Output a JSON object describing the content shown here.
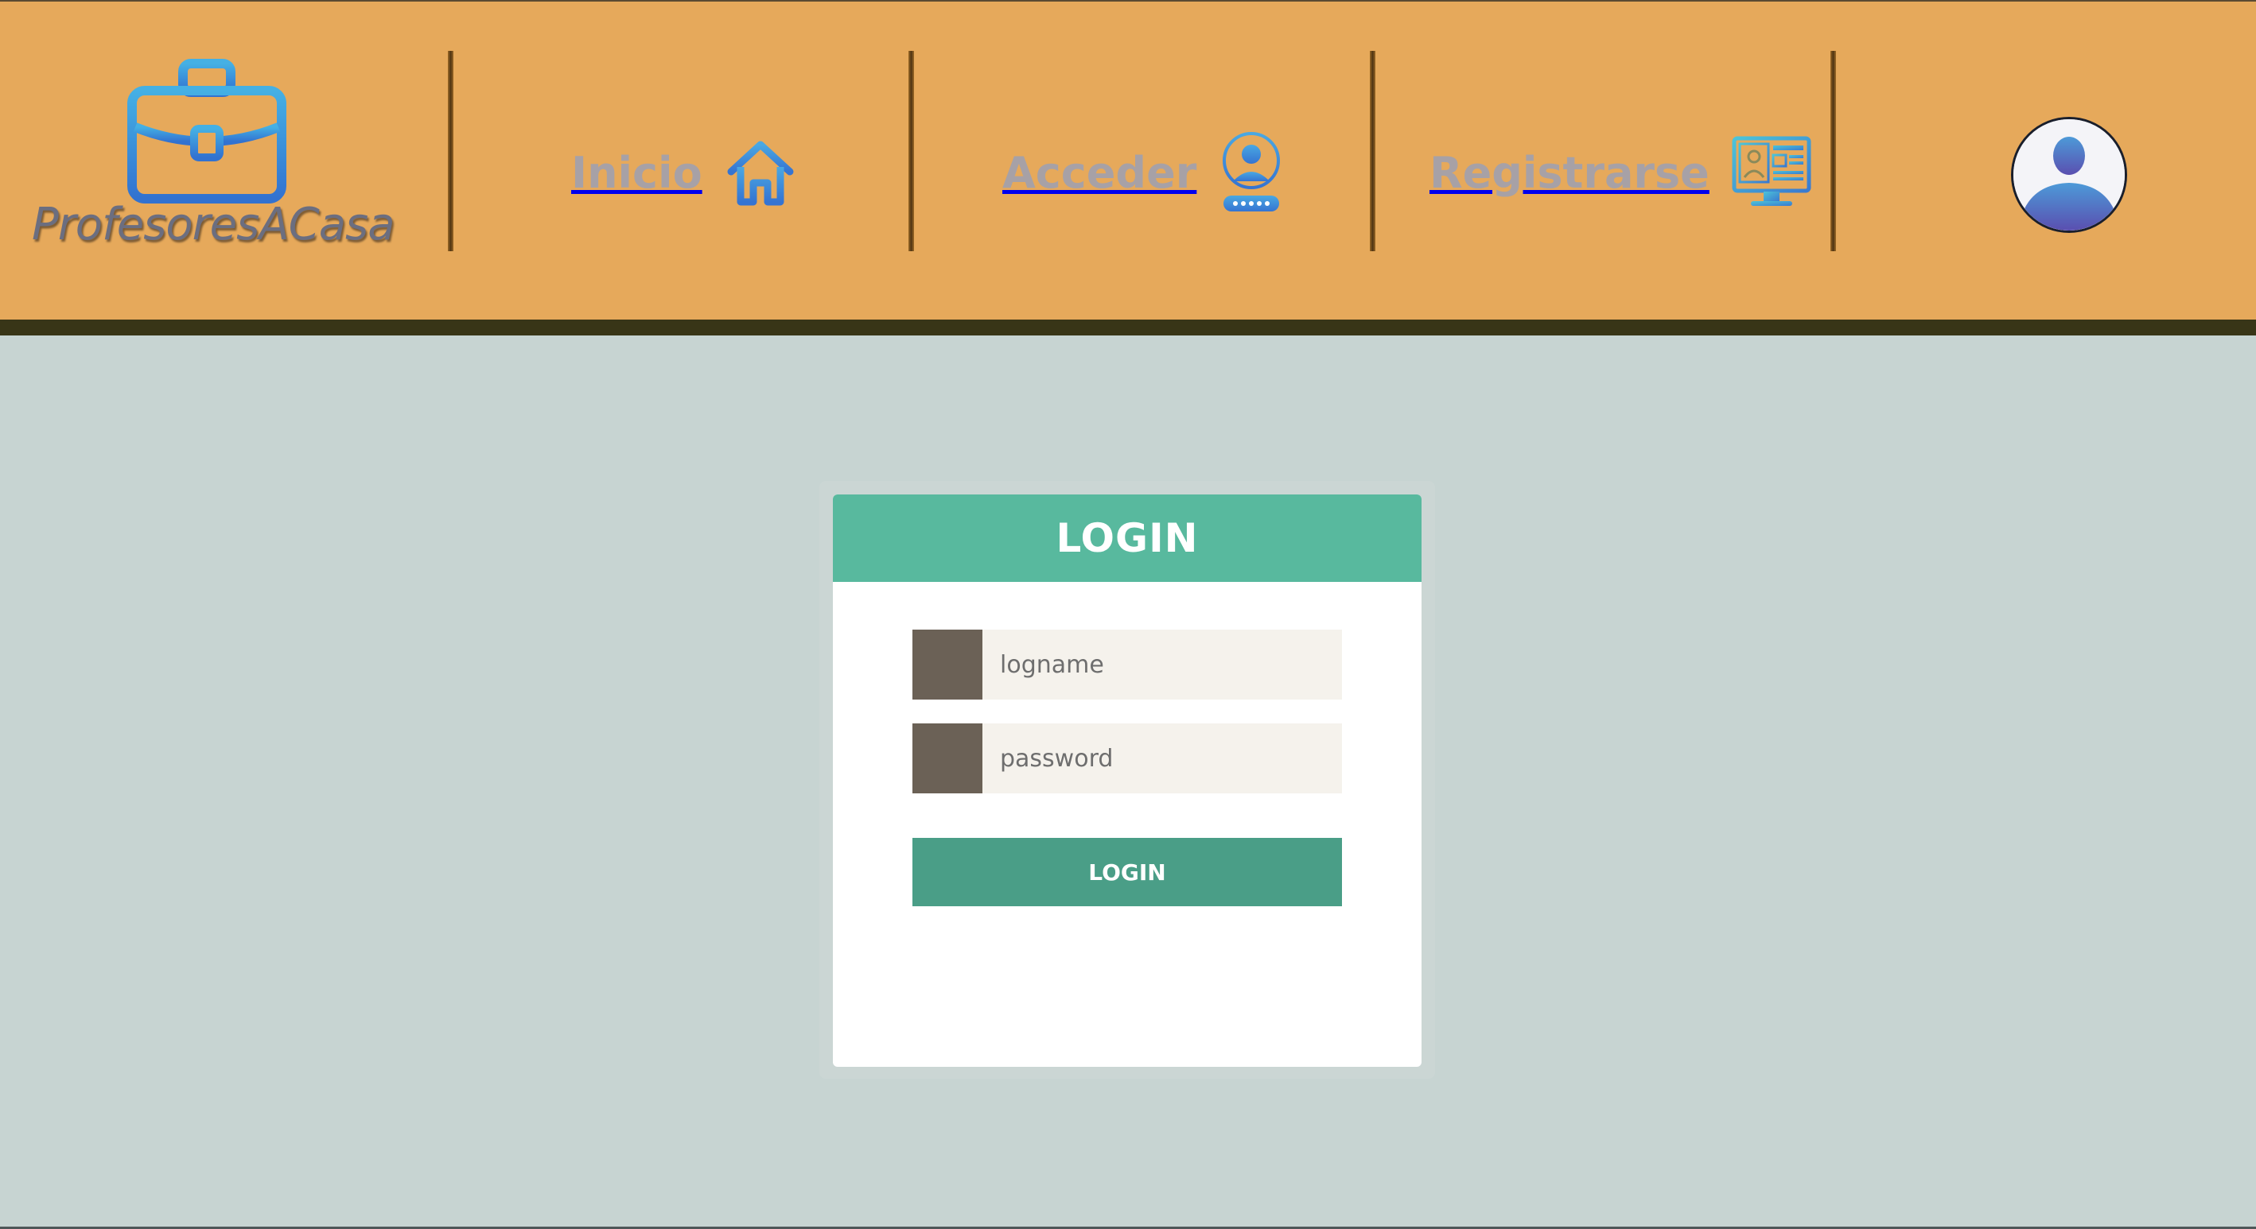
{
  "app": {
    "logo_text": "ProfesoresACasa"
  },
  "nav": {
    "items": [
      {
        "label": "Inicio",
        "icon": "home-icon"
      },
      {
        "label": "Acceder",
        "icon": "user-login-icon"
      },
      {
        "label": "Registrarse",
        "icon": "register-monitor-icon"
      }
    ],
    "avatar_icon": "user-avatar-icon"
  },
  "login": {
    "title": "LOGIN",
    "logname_placeholder": "logname",
    "password_placeholder": "password",
    "button_label": "LOGIN"
  },
  "colors": {
    "header_bg": "#e6a95b",
    "header_rule": "#383517",
    "page_bg": "#c7d4d2",
    "card_header": "#58b99e",
    "login_button": "#4a9e87",
    "field_icon": "#6b6156",
    "field_bg": "#f5f2ec",
    "nav_text": "#a7a1a6",
    "icon_blue": "#3a8ad6"
  }
}
